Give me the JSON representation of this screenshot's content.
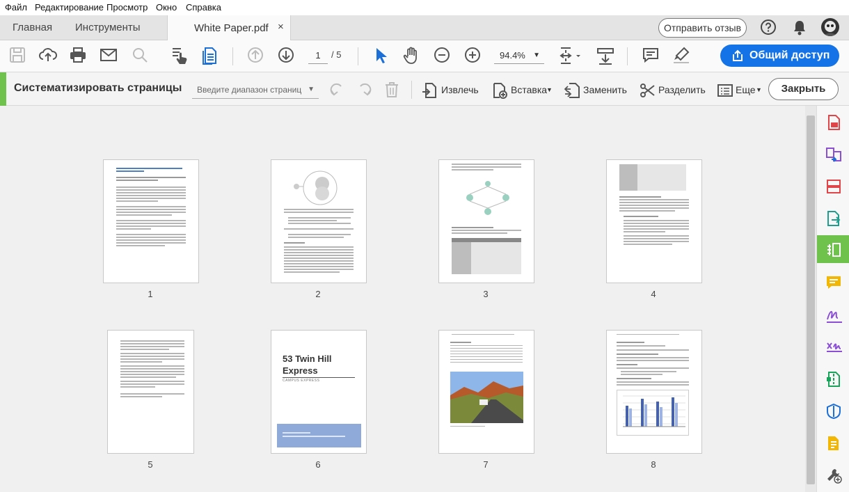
{
  "menu": [
    "Файл",
    "Редактирование",
    "Просмотр",
    "Окно",
    "Справка"
  ],
  "tabs": {
    "home": "Главная",
    "tools": "Инструменты",
    "document": "White Paper.pdf",
    "close_glyph": "×",
    "feedback": "Отправить отзыв"
  },
  "toolbar": {
    "page_current": "1",
    "page_total": "/ 5",
    "zoom": "94.4%",
    "share": "Общий доступ"
  },
  "organize": {
    "title": "Систематизировать страницы",
    "range_placeholder": "Введите диапазон страниц",
    "extract": "Извлечь",
    "insert": "Вставка",
    "replace": "Заменить",
    "split": "Разделить",
    "more": "Еще",
    "close": "Закрыть"
  },
  "pages": [
    {
      "number": "1"
    },
    {
      "number": "2"
    },
    {
      "number": "3"
    },
    {
      "number": "4"
    },
    {
      "number": "5"
    },
    {
      "number": "6",
      "cover_title": "53 Twin Hill Express",
      "cover_subtitle": "CAMPUS EXPRESS"
    },
    {
      "number": "7"
    },
    {
      "number": "8"
    }
  ],
  "colors": {
    "accent_green": "#6fc34c",
    "share_blue": "#1473e6",
    "icon_blue": "#1b6fd6",
    "rail_red": "#e0454a",
    "rail_purple": "#8b4fd6",
    "rail_yellow": "#f2b705"
  },
  "icons": {
    "toolbar": [
      "save-icon",
      "upload-cloud-icon",
      "print-icon",
      "email-icon",
      "search-icon",
      "hand-pointer-icon",
      "document-icon",
      "page-up-icon",
      "page-down-icon",
      "select-arrow-icon",
      "pan-hand-icon",
      "zoom-out-icon",
      "zoom-in-icon",
      "fit-page-icon",
      "scroll-mode-icon",
      "comment-icon",
      "highlighter-icon"
    ],
    "rail": [
      "create-pdf-icon",
      "combine-files-icon",
      "organize-pages-icon",
      "export-pdf-icon",
      "edit-pdf-icon",
      "comment-icon",
      "fill-sign-icon",
      "send-for-signature-icon",
      "compress-icon",
      "protect-icon",
      "export-pdf-icon",
      "more-tools-icon"
    ]
  }
}
